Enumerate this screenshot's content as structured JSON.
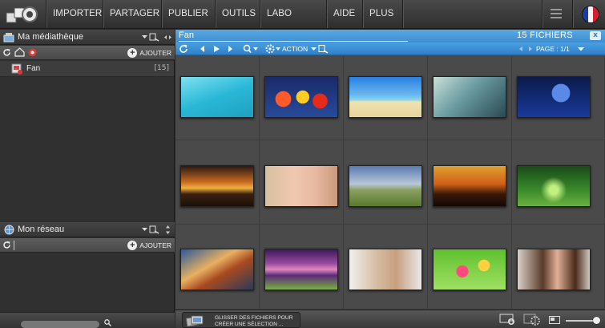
{
  "topbar": {
    "menu": [
      "IMPORTER",
      "PARTAGER",
      "PUBLIER",
      "OUTILS",
      "LABO PHOTO",
      "AIDE",
      "PLUS"
    ]
  },
  "library": {
    "title": "Ma médiathèque",
    "add_label": "AJOUTER",
    "items": [
      {
        "label": "Fan",
        "count": "[15]"
      }
    ]
  },
  "network": {
    "title": "Mon réseau",
    "add_label": "AJOUTER"
  },
  "viewer": {
    "folder": "Fan",
    "file_count": "15 FICHIERS",
    "action_label": "ACTION",
    "page_label": "PAGE : 1/1",
    "close_label": "x"
  },
  "dropzone": {
    "line1": "GLISSER DES FICHIERS POUR",
    "line2": "CRÉER UNE SÉLECTION ..."
  },
  "thumbnails": [
    {
      "name": "tropical-water-leaf",
      "bg": "linear-gradient(160deg,#7fe0f0 0%,#2ab8d8 50%,#1e9fbf 100%)"
    },
    {
      "name": "hot-air-balloons",
      "bg": "radial-gradient(circle at 25% 55%,#ff5a2a 0 13%,transparent 14%),radial-gradient(circle at 52% 50%,#ffcc22 0 15%,transparent 16%),radial-gradient(circle at 76% 60%,#e82a1a 0 12%,transparent 13%),linear-gradient(#1a2a6a,#284a9a)"
    },
    {
      "name": "beach-palm",
      "bg": "linear-gradient(#2a7fe0 0%,#6ab8f0 45%,#8fd8e8 58%,#f0e2b0 62%,#e8d49c 100%)"
    },
    {
      "name": "fantasy-girl",
      "bg": "linear-gradient(135deg,#c8e0d8 0%,#6a9aa0 45%,#2a4a52 100%)"
    },
    {
      "name": "panda-night",
      "bg": "radial-gradient(circle at 60% 40%,#5a8ae8 0 18%,transparent 19%),linear-gradient(#0a1a4a,#1a3a9a)"
    },
    {
      "name": "sunset-lake",
      "bg": "linear-gradient(#2a1a14 0%,#c86a20 40%,#f0b040 55%,#3a2010 70%,#1a1008 100%)"
    },
    {
      "name": "blonde-portrait",
      "bg": "linear-gradient(90deg,#d8c0a0 0%,#f0c8b0 40%,#e8b8a0 70%,#c89a7a 100%)"
    },
    {
      "name": "field-tree-sky",
      "bg": "linear-gradient(#5a7ab0 0%,#b8c8d8 45%,#8aa060 60%,#5a7a30 100%)"
    },
    {
      "name": "palm-sunset",
      "bg": "linear-gradient(#e0a030 0%,#d06018 45%,#3a1808 70%,#120804 100%)"
    },
    {
      "name": "green-road",
      "bg": "radial-gradient(circle at 50% 60%,#c0f080 0 10%,transparent 30%),linear-gradient(#1a4a1a,#3a8a2a 60%,#6ab040)"
    },
    {
      "name": "mountain-peak",
      "bg": "linear-gradient(150deg,#2a5a9a 0%,#e8b060 40%,#a84a20 60%,#2a3a5a 100%)"
    },
    {
      "name": "purple-lake",
      "bg": "linear-gradient(#3a1a5a 0%,#9a4aa0 35%,#e088c0 50%,#5a2a7a 65%,#7ab040 100%)"
    },
    {
      "name": "woman-portrait",
      "bg": "linear-gradient(90deg,#f0f0f0 0%,#d8c0a8 35%,#c8a080 65%,#e8e8e8 100%)"
    },
    {
      "name": "colorful-flowers",
      "bg": "radial-gradient(circle at 40% 55%,#ff4a80 0 12%,transparent 13%),radial-gradient(circle at 70% 40%,#ffd040 0 10%,transparent 11%),linear-gradient(#60c030,#a0e060)"
    },
    {
      "name": "brunette-portrait",
      "bg": "linear-gradient(90deg,#d8d0c8 0%,#5a3a2a 35%,#e0b098 55%,#4a2a1a 80%,#d0c8c0 100%)"
    }
  ]
}
